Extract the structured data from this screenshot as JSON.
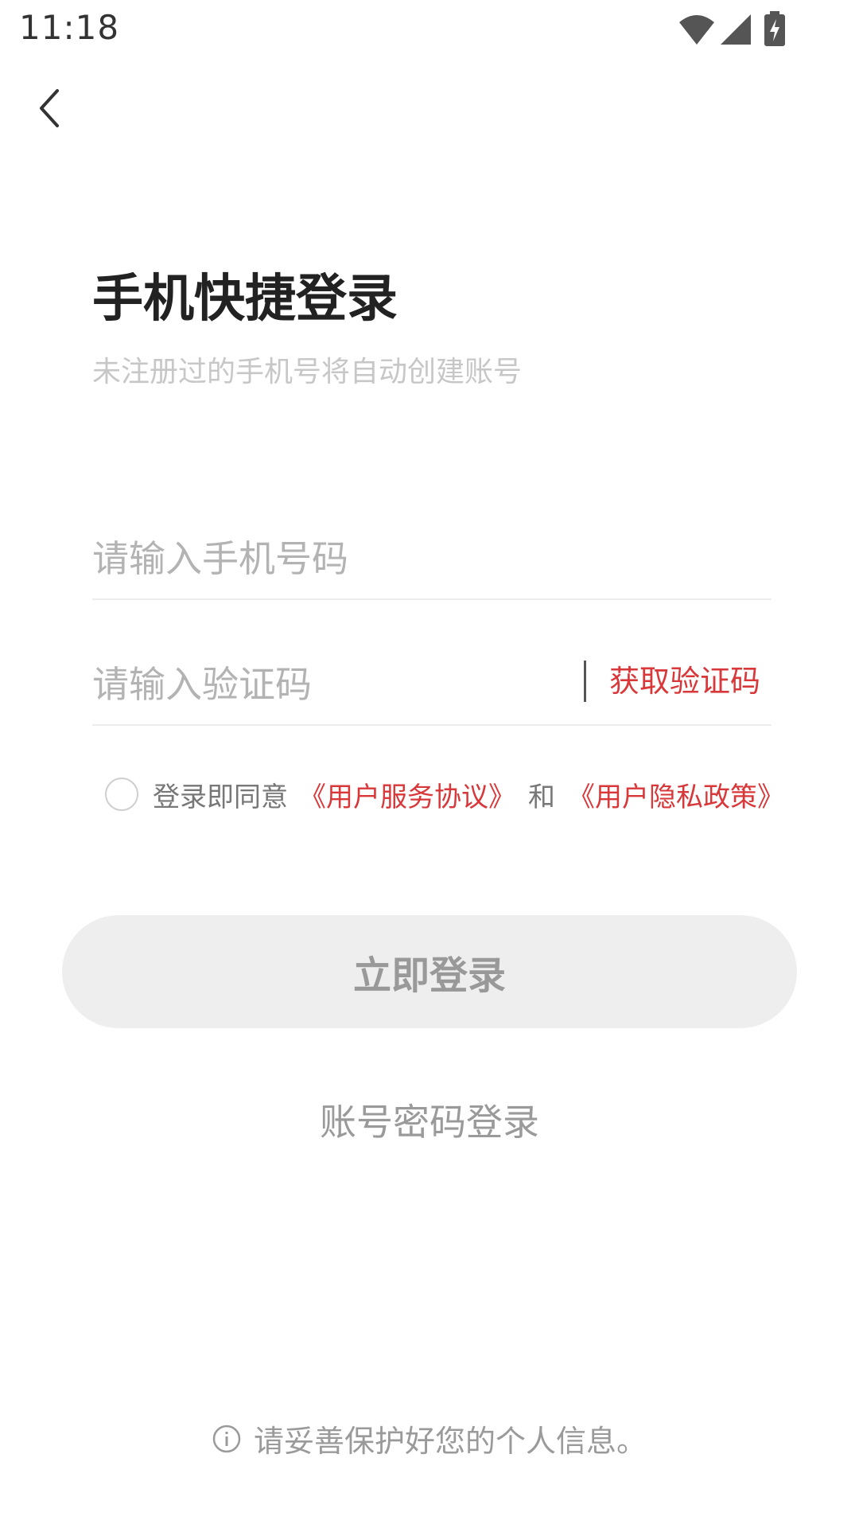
{
  "status_bar": {
    "time": "11:18",
    "icons": [
      "wifi-icon",
      "cell-signal-icon",
      "battery-charging-icon"
    ]
  },
  "header": {
    "back_icon": "chevron-left-icon"
  },
  "title": "手机快捷登录",
  "subtitle": "未注册过的手机号将自动创建账号",
  "phone_input": {
    "placeholder": "请输入手机号码",
    "value": ""
  },
  "code_input": {
    "placeholder": "请输入验证码",
    "value": "",
    "get_code_label": "获取验证码"
  },
  "agreement": {
    "checked": false,
    "prefix": "登录即同意",
    "terms_link": "《用户服务协议》",
    "and": "和",
    "privacy_link": "《用户隐私政策》"
  },
  "login_button": "立即登录",
  "password_login_link": "账号密码登录",
  "footer_tip": "请妥善保护好您的个人信息。",
  "colors": {
    "accent": "#d8383a",
    "button_bg": "#eeeeee",
    "placeholder": "#b3b3b3",
    "subtitle": "#c7c7c7"
  }
}
